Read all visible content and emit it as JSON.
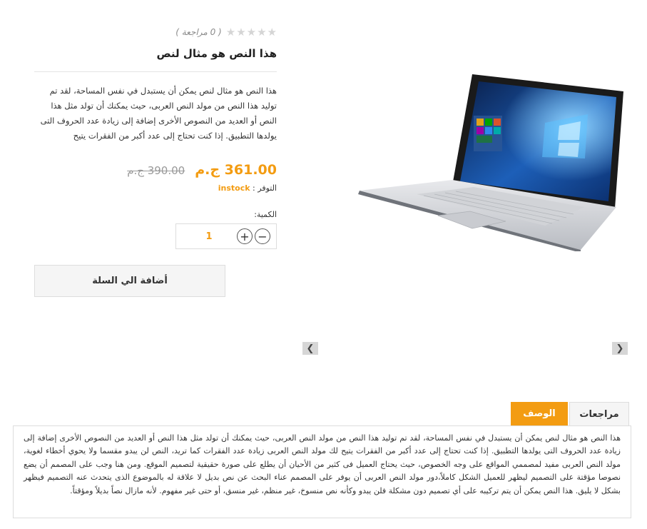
{
  "product": {
    "title": "هذا النص هو مثال لنص",
    "rating": {
      "stars_filled": 0,
      "stars_total": 5,
      "review_label": "( 0 مراجعة )"
    },
    "description": "هذا النص هو مثال لنص يمكن أن يستبدل في نفس المساحة، لقد تم توليد هذا النص من مولد النص العربى، حيث يمكنك أن تولد مثل هذا النص أو العديد من النصوص الأخرى إضافة إلى زيادة عدد الحروف التى يولدها التطبيق. إذا كنت تحتاج إلى عدد أكبر من الفقرات يتيح",
    "price_new": "361.00 ج.م",
    "price_old": "390.00 ج.م",
    "stock_label": "التوفر :",
    "stock_value": "instock",
    "qty_label": "الكمية:",
    "qty_value": "1",
    "add_to_cart": "أضافة الي السلة"
  },
  "gallery": {
    "prev_icon": "chevron-left-icon",
    "next_icon": "chevron-right-icon"
  },
  "tabs": {
    "description_tab": "الوصف",
    "reviews_tab": "مراجعات",
    "panel_text": "هذا النص هو مثال لنص يمكن أن يستبدل في نفس المساحة، لقد تم توليد هذا النص من مولد النص العربى، حيث يمكنك أن تولد مثل هذا النص أو العديد من النصوص الأخرى إضافة إلى زيادة عدد الحروف التى يولدها التطبيق. إذا كنت تحتاج إلى عدد أكبر من الفقرات يتيح لك مولد النص العربى زيادة عدد الفقرات كما تريد، النص لن يبدو مقسما ولا يحوي أخطاء لغوية، مولد النص العربى مفيد لمصممي المواقع على وجه الخصوص، حيث يحتاج العميل فى كثير من الأحيان أن يطلع على صورة حقيقية لتصميم الموقع. ومن هنا وجب على المصمم أن يضع نصوصا مؤقتة على التصميم ليظهر للعميل الشكل كاملاً،دور مولد النص العربى أن يوفر على المصمم عناء البحث عن نص بديل لا علاقة له بالموضوع الذى يتحدث عنه التصميم فيظهر بشكل لا يليق. هذا النص يمكن أن يتم تركيبه على أي تصميم دون مشكلة فلن يبدو وكأنه نص منسوخ، غير منظم، غير منسق، أو حتى غير مفهوم. لأنه مازال نصاً بديلاً ومؤقتاً."
  },
  "colors": {
    "accent": "#f39c12",
    "star_empty": "#d5d5d5"
  }
}
